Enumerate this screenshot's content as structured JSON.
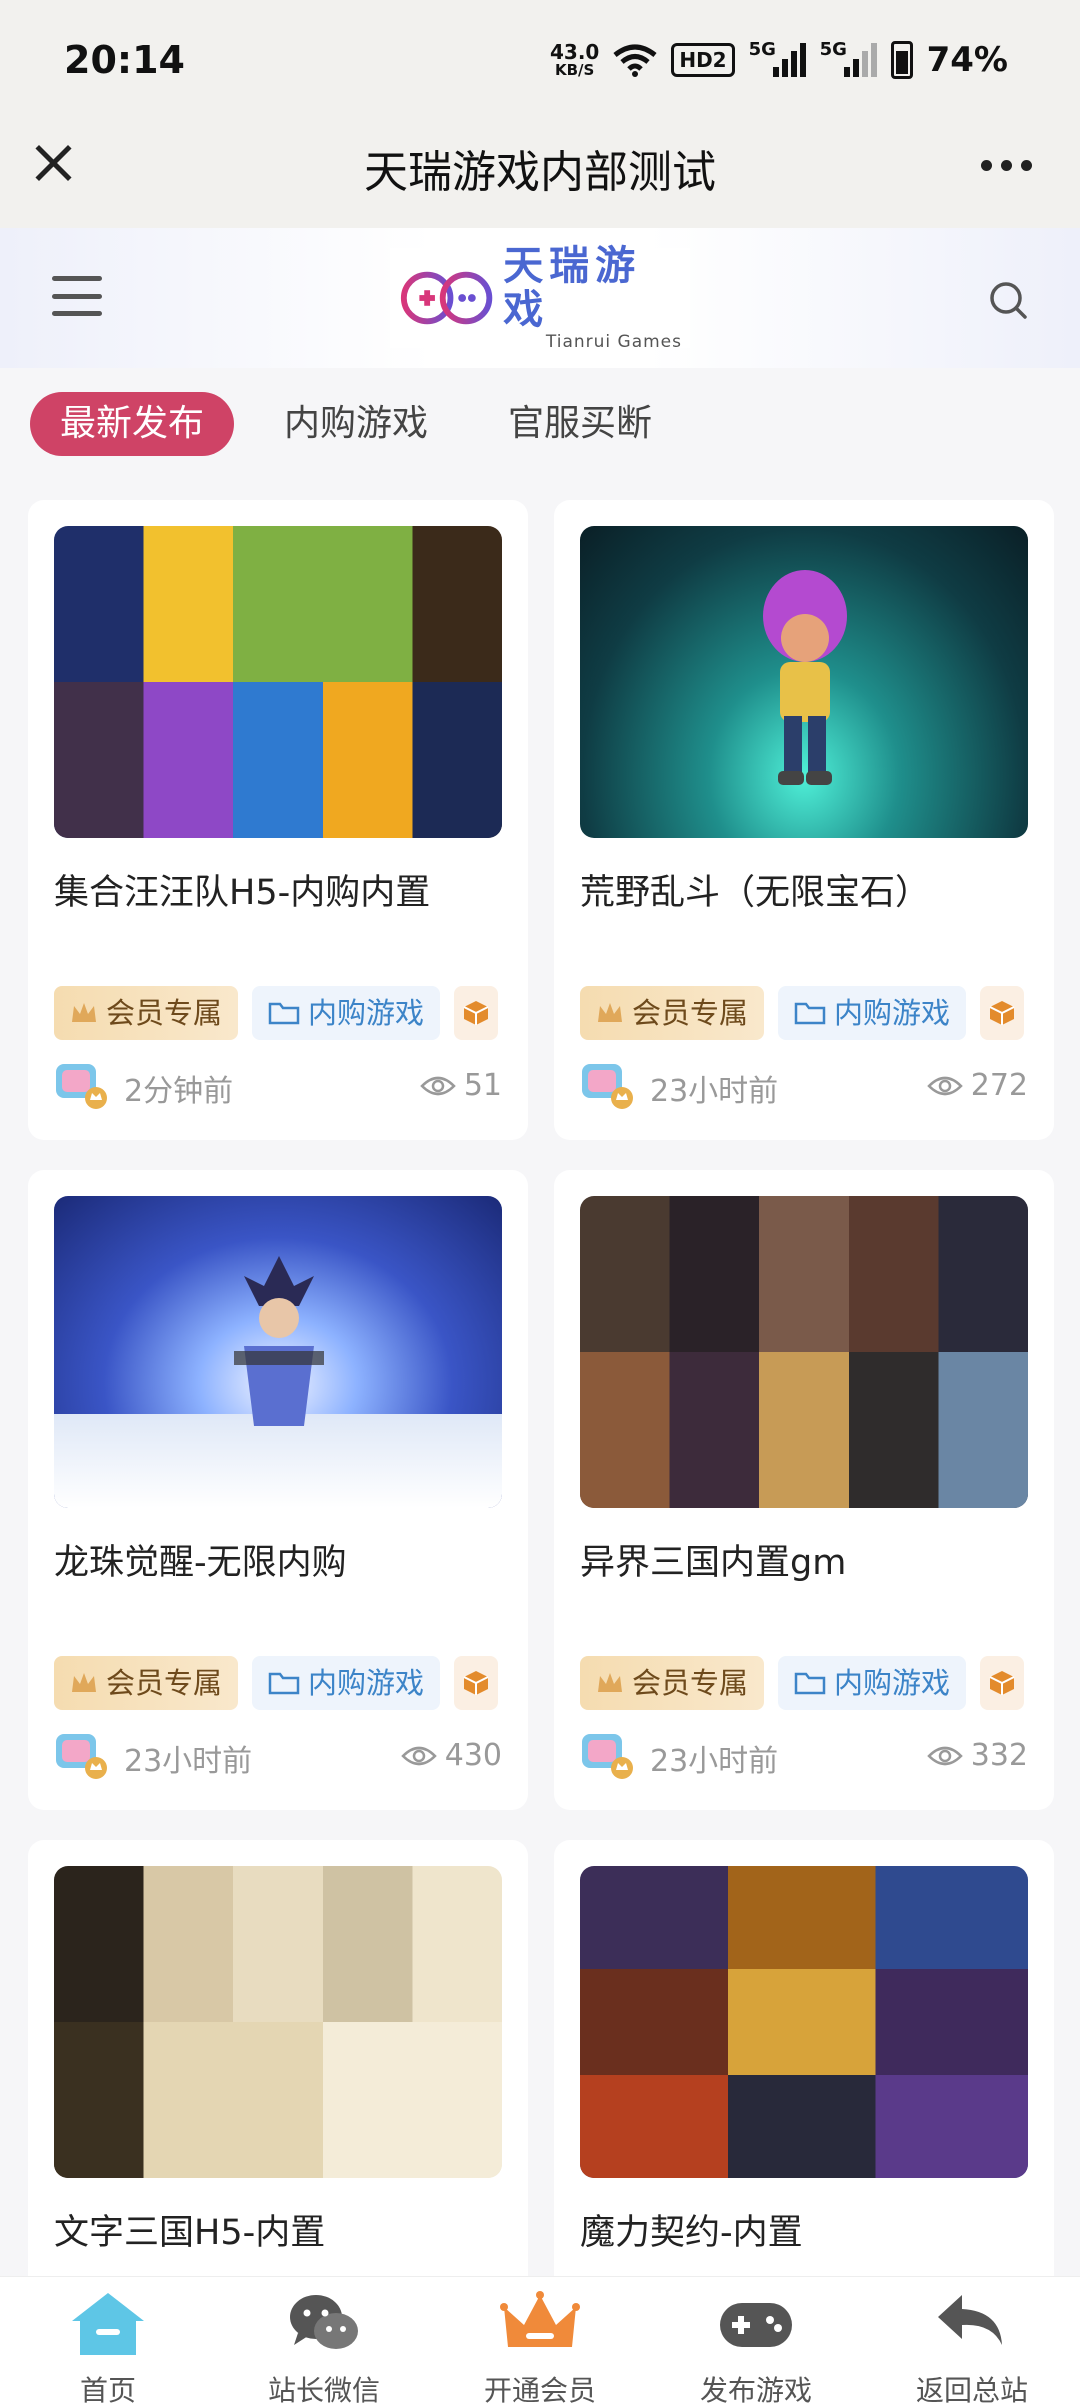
{
  "status_bar": {
    "time": "20:14",
    "net_speed_value": "43.0",
    "net_speed_unit": "KB/S",
    "hd_label": "HD2",
    "sig1_label": "5G",
    "sig2_label": "5G",
    "battery": "74%"
  },
  "titlebar": {
    "title": "天瑞游戏内部测试"
  },
  "site_header": {
    "logo_cn": "天瑞游戏",
    "logo_en": "Tianrui Games"
  },
  "tabs": [
    {
      "label": "最新发布",
      "active": true
    },
    {
      "label": "内购游戏",
      "active": false
    },
    {
      "label": "官服买断",
      "active": false
    }
  ],
  "tag_labels": {
    "vip": "会员专属",
    "iap": "内购游戏"
  },
  "cards": [
    {
      "title": "集合汪汪队H5-内购内置",
      "time": "2分钟前",
      "views": "51"
    },
    {
      "title": "荒野乱斗（无限宝石）",
      "time": "23小时前",
      "views": "272"
    },
    {
      "title": "龙珠觉醒-无限内购",
      "time": "23小时前",
      "views": "430"
    },
    {
      "title": "异界三国内置gm",
      "time": "23小时前",
      "views": "332"
    },
    {
      "title": "文字三国H5-内置"
    },
    {
      "title": "魔力契约-内置"
    }
  ],
  "bottom_nav": [
    {
      "label": "首页",
      "icon": "home-icon"
    },
    {
      "label": "站长微信",
      "icon": "wechat-icon"
    },
    {
      "label": "开通会员",
      "icon": "crown-icon"
    },
    {
      "label": "发布游戏",
      "icon": "gamepad-icon"
    },
    {
      "label": "返回总站",
      "icon": "back-arrow-icon"
    }
  ],
  "colors": {
    "accent": "#cf4366",
    "tag_vip_text": "#6e4a1c",
    "tag_iap_text": "#3c84c8",
    "nav_home": "#5ec6e6",
    "nav_crown": "#f08a3a"
  }
}
